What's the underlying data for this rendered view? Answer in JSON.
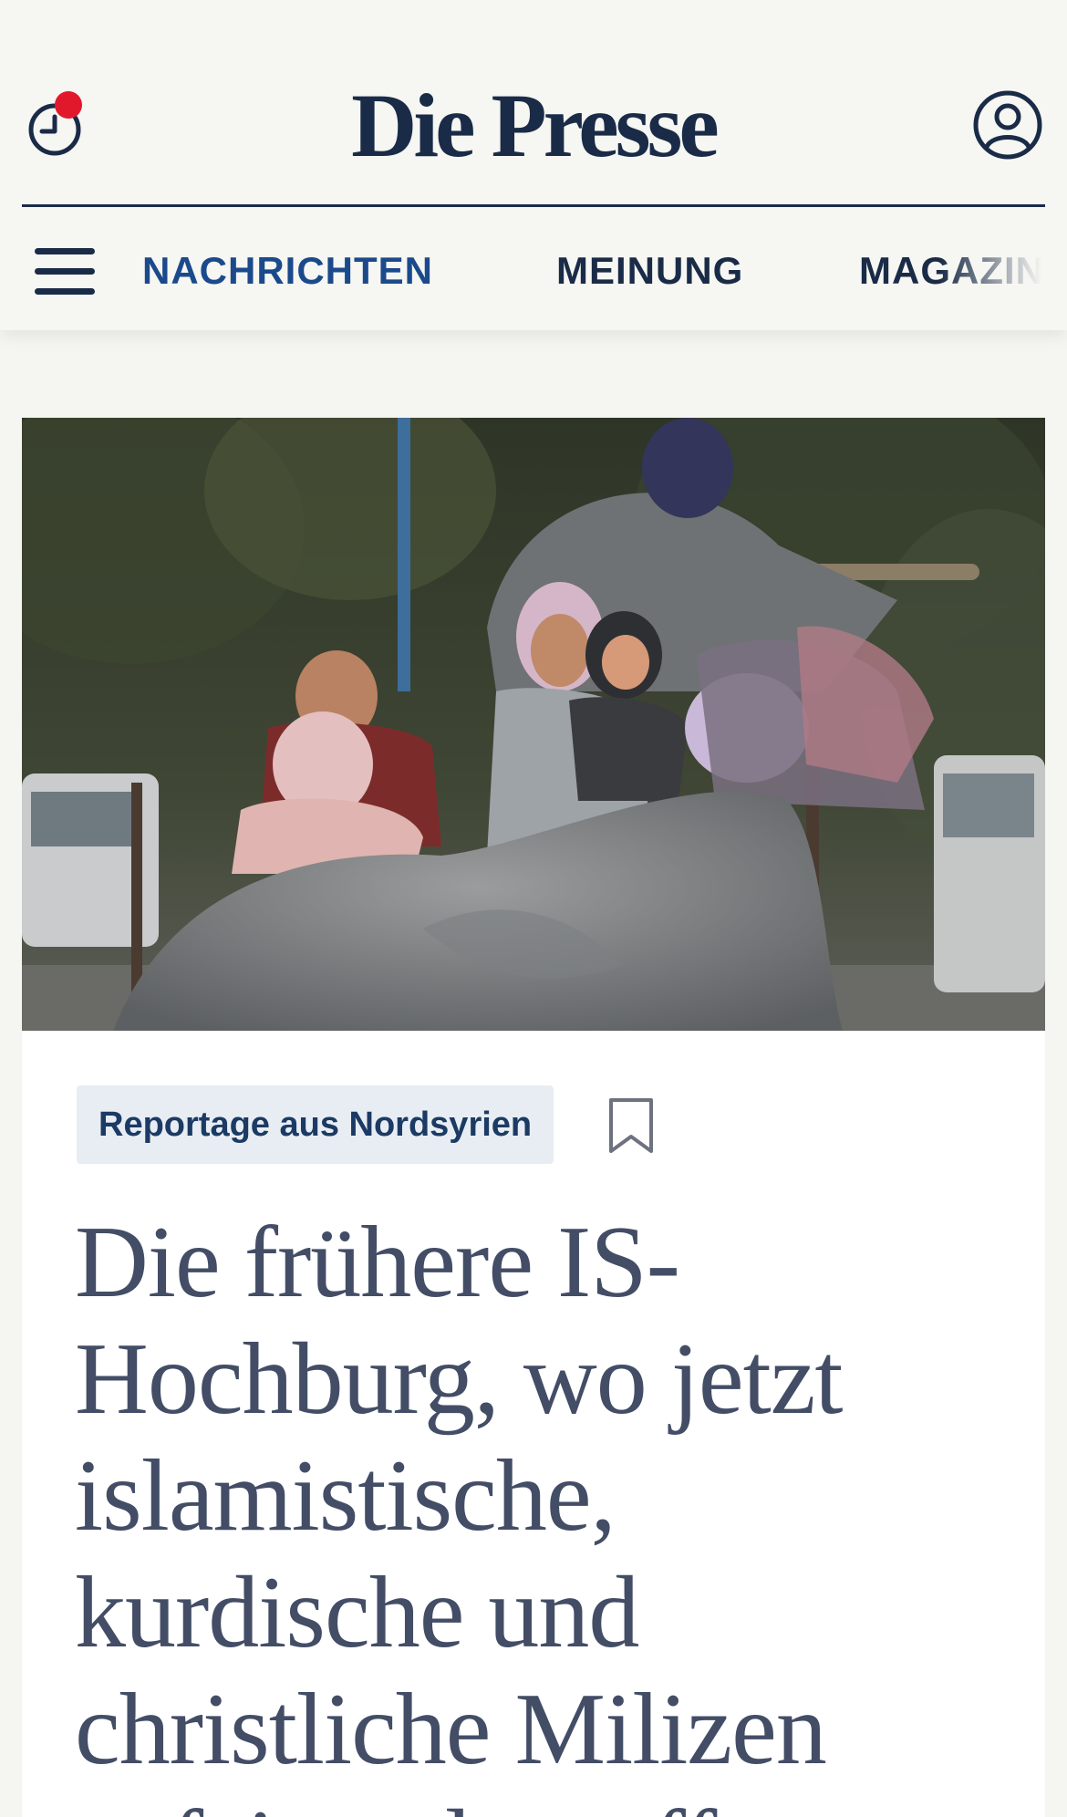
{
  "header": {
    "logo_text": "Die Presse",
    "history_icon": "clock-icon",
    "has_notification": true,
    "account_icon": "user-circle-icon"
  },
  "nav": {
    "menu_icon": "hamburger-menu-icon",
    "items": [
      {
        "label": "NACHRICHTEN",
        "active": true
      },
      {
        "label": "MEINUNG",
        "active": false
      },
      {
        "label": "MAGAZIN",
        "active": false
      }
    ]
  },
  "article": {
    "kicker": "Reportage aus Nordsyrien",
    "bookmark_icon": "bookmark-icon",
    "headline": "Die frühere IS-Hochburg, wo jetzt islamistische, kurdische und christliche Milizen aufeinandertreffen"
  },
  "colors": {
    "brand_navy": "#1a2b48",
    "accent_blue": "#1b4a8c",
    "notification_red": "#e1182c",
    "kicker_bg": "#e8edf3",
    "headline_text": "#434d66",
    "page_bg": "#f5f5f2"
  }
}
